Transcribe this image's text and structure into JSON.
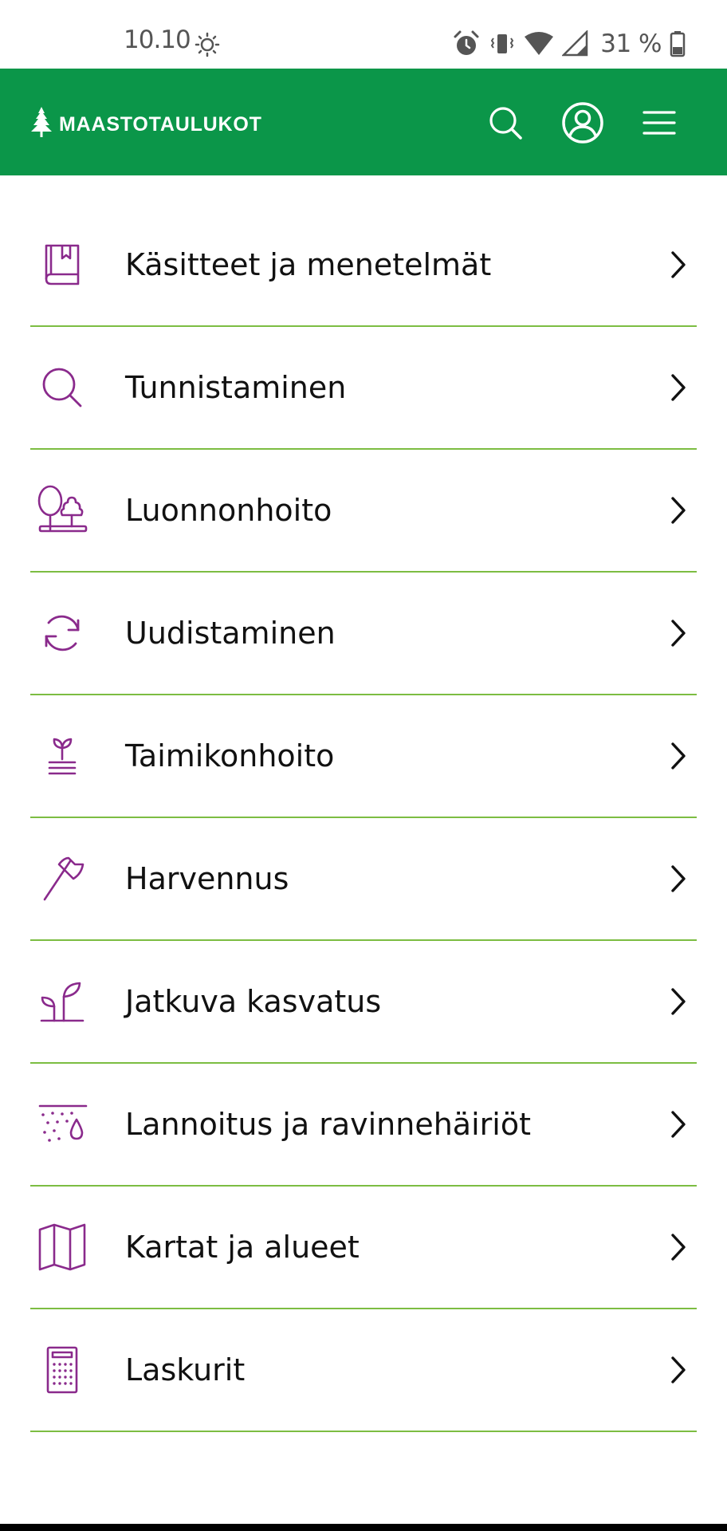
{
  "status_bar": {
    "time": "10.10",
    "battery_percent": "31 %",
    "icons": [
      "brightness-icon",
      "alarm-icon",
      "vibrate-icon",
      "wifi-icon",
      "cellular-signal-icon",
      "battery-icon"
    ]
  },
  "header": {
    "logo_text": "MAASTOTAULUKOT",
    "logo_icon": "tree-icon",
    "background_color": "#0b9649",
    "actions": [
      "search-icon",
      "account-icon",
      "hamburger-menu-icon"
    ]
  },
  "menu": {
    "icon_color": "#8a2a8c",
    "divider_color": "#7cbd42",
    "items": [
      {
        "label": "Käsitteet ja menetelmät",
        "icon": "book-icon"
      },
      {
        "label": "Tunnistaminen",
        "icon": "search-icon"
      },
      {
        "label": "Luonnonhoito",
        "icon": "trees-icon"
      },
      {
        "label": "Uudistaminen",
        "icon": "refresh-icon"
      },
      {
        "label": "Taimikonhoito",
        "icon": "seedling-rows-icon"
      },
      {
        "label": "Harvennus",
        "icon": "axe-icon"
      },
      {
        "label": "Jatkuva kasvatus",
        "icon": "sprout-icon"
      },
      {
        "label": "Lannoitus ja ravinnehäiriöt",
        "icon": "fertilizer-drop-icon"
      },
      {
        "label": "Kartat ja alueet",
        "icon": "map-icon"
      },
      {
        "label": "Laskurit",
        "icon": "calculator-icon"
      }
    ]
  }
}
